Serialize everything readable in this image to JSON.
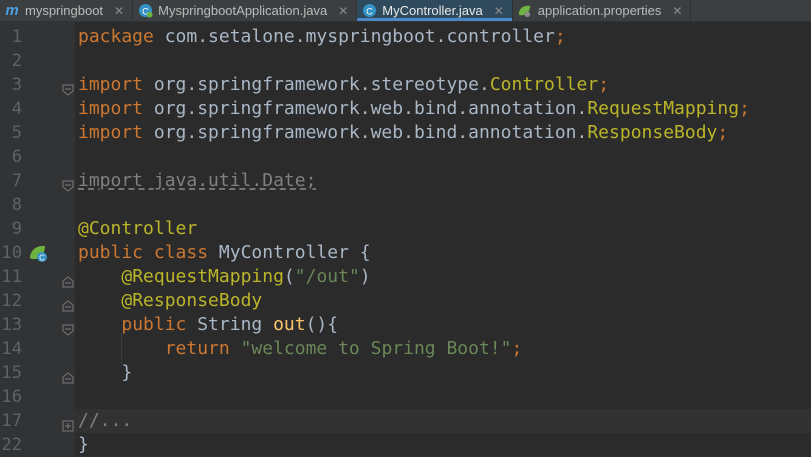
{
  "tabs": [
    {
      "label": "myspringboot",
      "icon": "maven-module-icon"
    },
    {
      "label": "MyspringbootApplication.java",
      "icon": "spring-boot-class-icon"
    },
    {
      "label": "MyController.java",
      "icon": "class-icon",
      "active": true
    },
    {
      "label": "application.properties",
      "icon": "spring-properties-icon"
    }
  ],
  "editor": {
    "line_numbers": [
      "1",
      "2",
      "3",
      "4",
      "5",
      "6",
      "7",
      "8",
      "9",
      "10",
      "11",
      "12",
      "13",
      "14",
      "15",
      "16",
      "17",
      "22"
    ],
    "lines": [
      {
        "segments": [
          {
            "t": "package ",
            "c": "kw"
          },
          {
            "t": "com.setalone.myspringboot.controller",
            "c": ""
          },
          {
            "t": ";",
            "c": "kw"
          }
        ]
      },
      {
        "segments": []
      },
      {
        "segments": [
          {
            "t": "import ",
            "c": "kw"
          },
          {
            "t": "org.springframework.stereotype.",
            "c": ""
          },
          {
            "t": "Controller",
            "c": "cls"
          },
          {
            "t": ";",
            "c": "kw"
          }
        ]
      },
      {
        "segments": [
          {
            "t": "import ",
            "c": "kw"
          },
          {
            "t": "org.springframework.web.bind.annotation.",
            "c": ""
          },
          {
            "t": "RequestMapping",
            "c": "cls"
          },
          {
            "t": ";",
            "c": "kw"
          }
        ]
      },
      {
        "segments": [
          {
            "t": "import ",
            "c": "kw"
          },
          {
            "t": "org.springframework.web.bind.annotation.",
            "c": ""
          },
          {
            "t": "ResponseBody",
            "c": "cls"
          },
          {
            "t": ";",
            "c": "kw"
          }
        ]
      },
      {
        "segments": []
      },
      {
        "segments": [
          {
            "t": "import java.util.Date;",
            "c": "unused"
          }
        ]
      },
      {
        "segments": []
      },
      {
        "segments": [
          {
            "t": "@Controller",
            "c": "ann"
          }
        ]
      },
      {
        "segments": [
          {
            "t": "public ",
            "c": "kw"
          },
          {
            "t": "class ",
            "c": "kw"
          },
          {
            "t": "MyController {",
            "c": ""
          }
        ]
      },
      {
        "segments": [
          {
            "t": "    ",
            "c": ""
          },
          {
            "t": "@RequestMapping",
            "c": "ann"
          },
          {
            "t": "(",
            "c": ""
          },
          {
            "t": "\"/out\"",
            "c": "str"
          },
          {
            "t": ")",
            "c": ""
          }
        ]
      },
      {
        "segments": [
          {
            "t": "    ",
            "c": ""
          },
          {
            "t": "@ResponseBody",
            "c": "ann"
          }
        ]
      },
      {
        "segments": [
          {
            "t": "    ",
            "c": ""
          },
          {
            "t": "public ",
            "c": "kw"
          },
          {
            "t": "String ",
            "c": ""
          },
          {
            "t": "out",
            "c": "fn"
          },
          {
            "t": "(){",
            "c": ""
          }
        ]
      },
      {
        "segments": [
          {
            "t": "        ",
            "c": ""
          },
          {
            "t": "return ",
            "c": "kw"
          },
          {
            "t": "\"welcome to Spring Boot!\"",
            "c": "str"
          },
          {
            "t": ";",
            "c": "kw"
          }
        ]
      },
      {
        "segments": [
          {
            "t": "    }",
            "c": ""
          }
        ]
      },
      {
        "segments": []
      },
      {
        "segments": [
          {
            "t": "//...",
            "c": "com"
          }
        ]
      },
      {
        "segments": [
          {
            "t": "}",
            "c": ""
          }
        ]
      }
    ]
  }
}
